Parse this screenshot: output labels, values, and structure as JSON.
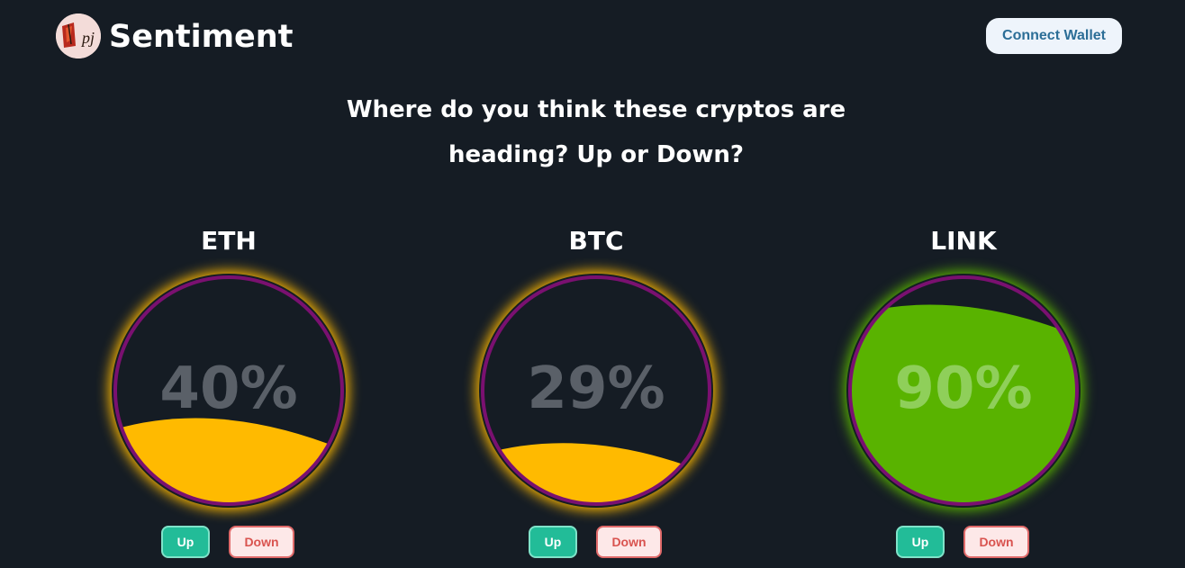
{
  "header": {
    "logo_icon": "pj-logo-icon",
    "brand": "Sentiment",
    "connect_label": "Connect Wallet"
  },
  "question": "Where do you think these cryptos are heading? Up or Down?",
  "cards": [
    {
      "symbol": "ETH",
      "percent_label": "40%",
      "up_fraction": 0.4,
      "fill_color": "#ffba00",
      "glow_color": "#ffba00",
      "up_label": "Up",
      "down_label": "Down"
    },
    {
      "symbol": "BTC",
      "percent_label": "29%",
      "up_fraction": 0.29,
      "fill_color": "#ffba00",
      "glow_color": "#ffba00",
      "up_label": "Up",
      "down_label": "Down"
    },
    {
      "symbol": "LINK",
      "percent_label": "90%",
      "up_fraction": 0.9,
      "fill_color": "#59b300",
      "glow_color": "#59b300",
      "up_label": "Up",
      "down_label": "Down"
    }
  ],
  "colors": {
    "background": "#151c24",
    "ring": "#7a1070",
    "percent_text_dark": "#5a6068",
    "percent_text_light": "#8fcf5a"
  }
}
